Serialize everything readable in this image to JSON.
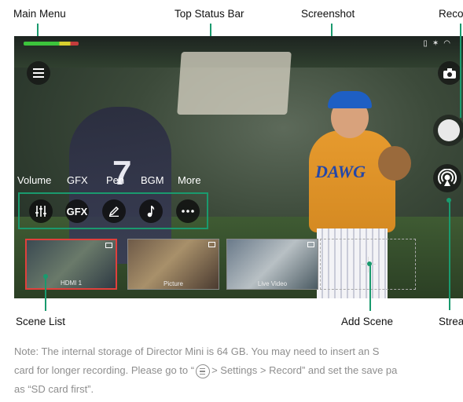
{
  "callouts": {
    "main_menu": "Main Menu",
    "top_status_bar": "Top Status Bar",
    "screenshot": "Screenshot",
    "record": "Reco",
    "scene_list": "Scene List",
    "add_scene": "Add Scene",
    "stream": "Strea"
  },
  "toolbar": {
    "labels": [
      "Volume",
      "GFX",
      "Pen",
      "BGM",
      "More"
    ],
    "gfx_button_text": "GFX"
  },
  "scenes": [
    {
      "caption": "HDMI 1",
      "active": true
    },
    {
      "caption": "Picture",
      "active": false
    },
    {
      "caption": "Live Video",
      "active": false
    }
  ],
  "screen_text": {
    "left_jersey_number": "7",
    "right_jersey_text": "DAWG"
  },
  "note": {
    "line1": "Note: The internal storage of Director Mini is  64 GB.  You may need to insert an S",
    "line2_before_icon": "card for longer recording. Please go to “",
    "line2_after_icon": "> Settings > Record” and set the save pa",
    "line3": "as “SD card first”."
  },
  "icons": [
    "menu-icon",
    "camera-icon",
    "record-icon",
    "stream-icon",
    "volume-sliders-icon",
    "pen-icon",
    "music-note-icon",
    "more-dots-icon",
    "plus-icon"
  ],
  "colors": {
    "accent": "#1a9a6e",
    "active_scene": "#e0403c",
    "note_text": "#8e8e8e"
  }
}
